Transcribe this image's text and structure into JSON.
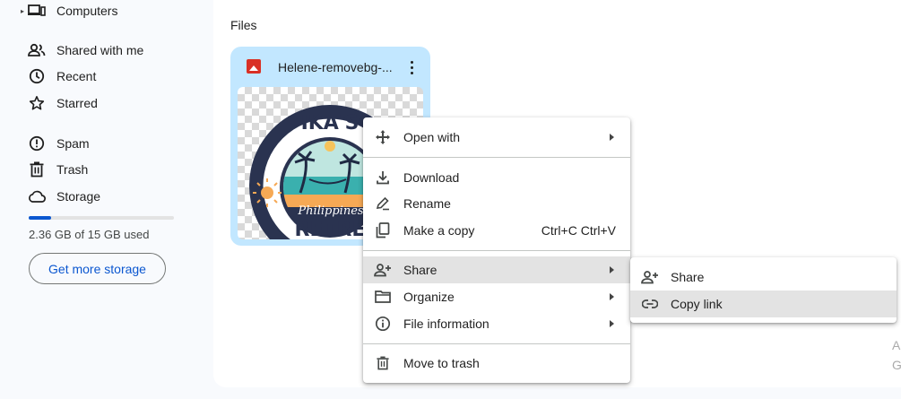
{
  "sidebar": {
    "items": [
      {
        "label": "Computers",
        "icon": "computer-icon"
      },
      {
        "label": "Shared with me",
        "icon": "people-icon"
      },
      {
        "label": "Recent",
        "icon": "clock-icon"
      },
      {
        "label": "Starred",
        "icon": "star-icon"
      },
      {
        "label": "Spam",
        "icon": "spam-icon"
      },
      {
        "label": "Trash",
        "icon": "trash-icon"
      },
      {
        "label": "Storage",
        "icon": "cloud-icon"
      }
    ],
    "storage": {
      "used_text": "2.36 GB of 15 GB used",
      "used_fraction": 0.157
    },
    "get_storage_label": "Get more storage"
  },
  "main": {
    "section_title": "Files",
    "file": {
      "name": "Helene-removebg-...",
      "type_icon": "image-icon",
      "thumbnail": {
        "line1": "IKA'S",
        "script_text": "Philippines",
        "line2": "RETRE"
      }
    },
    "right_hint": [
      "A",
      "G"
    ]
  },
  "context_menu": {
    "items": [
      {
        "label": "Open with",
        "icon": "open-with-icon",
        "submenu": true
      },
      {
        "label": "Download",
        "icon": "download-icon"
      },
      {
        "label": "Rename",
        "icon": "rename-icon"
      },
      {
        "label": "Make a copy",
        "icon": "copy-icon",
        "shortcut": "Ctrl+C Ctrl+V"
      },
      {
        "label": "Share",
        "icon": "share-person-icon",
        "submenu": true,
        "active": true
      },
      {
        "label": "Organize",
        "icon": "folder-icon",
        "submenu": true
      },
      {
        "label": "File information",
        "icon": "info-icon",
        "submenu": true
      },
      {
        "label": "Move to trash",
        "icon": "trash-icon"
      }
    ]
  },
  "share_submenu": {
    "items": [
      {
        "label": "Share",
        "icon": "share-person-icon"
      },
      {
        "label": "Copy link",
        "icon": "link-icon",
        "active": true
      }
    ]
  },
  "colors": {
    "accent": "#0b57d0",
    "card_bg": "#c2e7ff",
    "hover_bg": "#e3e3e3",
    "image_badge": "#d93025"
  }
}
